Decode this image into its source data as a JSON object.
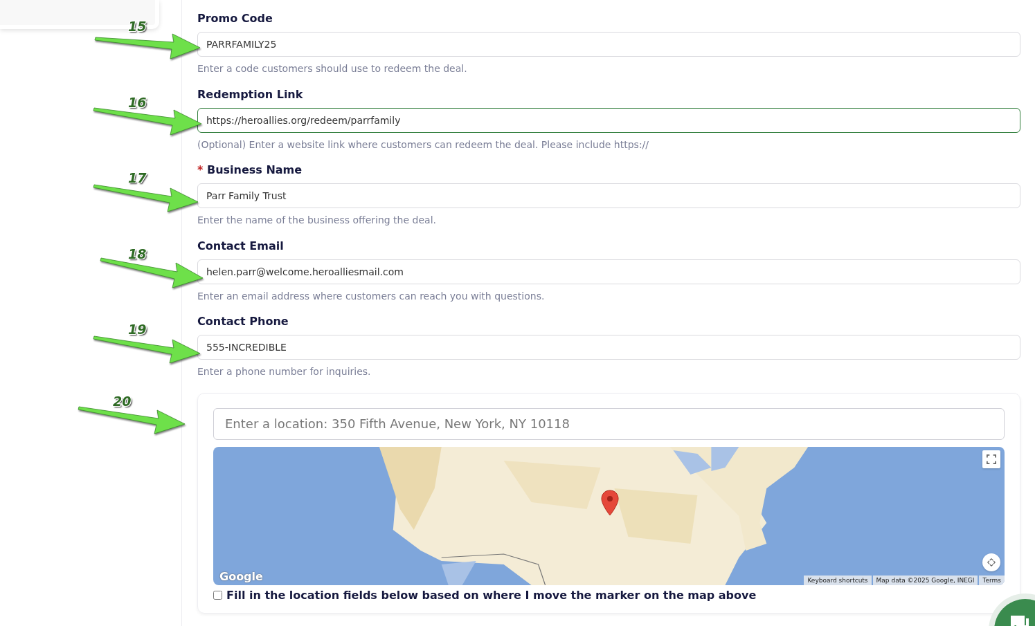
{
  "fields": [
    {
      "label": "Promo Code",
      "value": "PARRFAMILY25",
      "focused": false,
      "help": "Enter a code customers should use to redeem the deal.",
      "annotation": "15"
    },
    {
      "label": "Redemption Link",
      "value": "https://heroallies.org/redeem/parrfamily",
      "focused": true,
      "help": "(Optional) Enter a website link where customers can redeem the deal. Please include https://",
      "annotation": "16"
    },
    {
      "label": "Business Name",
      "required_marker": "*",
      "value": "Parr Family Trust",
      "focused": false,
      "help": "Enter the name of the business offering the deal.",
      "annotation": "17"
    },
    {
      "label": "Contact Email",
      "value": "helen.parr@welcome.heroalliesmail.com",
      "focused": false,
      "help": "Enter an email address where customers can reach you with questions.",
      "annotation": "18"
    },
    {
      "label": "Contact Phone",
      "value": "555-INCREDIBLE",
      "focused": false,
      "help": "Enter a phone number for inquiries.",
      "annotation": "19"
    }
  ],
  "location": {
    "annotation": "20",
    "placeholder": "Enter a location: 350 Fifth Avenue, New York, NY 10118",
    "map": {
      "kind": "picture",
      "logo": "Google",
      "attribution": [
        "Keyboard shortcuts",
        "Map data ©2025 Google, INEGI",
        "Terms"
      ]
    },
    "checkbox": {
      "label": "Fill in the location fields below based on where I move the marker on the map above",
      "checked": false
    }
  }
}
